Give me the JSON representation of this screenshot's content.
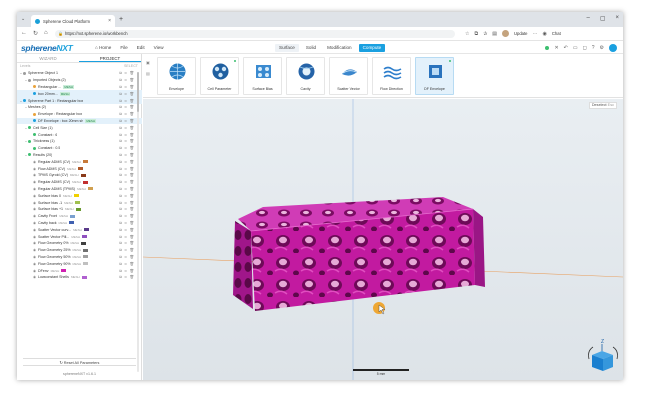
{
  "browser": {
    "tab_title": "Spherene Cloud Platform",
    "url": "https://nxt.spherene.io/workbench",
    "update_label": "Update",
    "profile_label": "Chat"
  },
  "app": {
    "logo": "sphereneNXT",
    "logo_main": "spherene",
    "logo_accent": "NXT",
    "menus": [
      "Home",
      "File",
      "Edit",
      "View"
    ],
    "modes": [
      "Surface",
      "Solid",
      "Modification",
      "Compute"
    ],
    "active_mode": "Surface",
    "user_initial": "B"
  },
  "left_panel": {
    "tabs": [
      "WIZARD",
      "PROJECT"
    ],
    "active_tab": "PROJECT",
    "sub_left": "Levels",
    "sub_right": "SELECT",
    "tree": [
      {
        "level": 0,
        "caret": "v",
        "label": "Spherene Object 1",
        "color": "#9b9b9b",
        "sel": false
      },
      {
        "level": 1,
        "caret": "v",
        "label": "Imported Objects (2)",
        "color": "#9b9b9b",
        "sel": false
      },
      {
        "level": 2,
        "caret": "",
        "label": "Rectangular ...",
        "mesh": "MESH",
        "color": "#e9a23b",
        "sel": false
      },
      {
        "level": 2,
        "caret": "",
        "label": "box 20mm...",
        "mesh": "MESH",
        "color": "#1aa0e0",
        "sel": true
      },
      {
        "level": 0,
        "caret": "v",
        "label": "Spherene Part 1 : Rectangular box",
        "color": "#1aa0e0",
        "sel": true
      },
      {
        "level": 1,
        "caret": "v",
        "label": "Meshes (2)",
        "color": "",
        "sel": false
      },
      {
        "level": 2,
        "caret": "",
        "label": "Envelope : Rectangular box",
        "color": "#e9a23b",
        "sel": false
      },
      {
        "level": 2,
        "caret": "",
        "label": "DF Envelope : box 20mm sh",
        "mesh": "MESH",
        "color": "#1aa0e0",
        "sel": true
      },
      {
        "level": 1,
        "caret": "v",
        "label": "Cell Size (1)",
        "color": "#3cbf6f",
        "sel": false
      },
      {
        "level": 2,
        "caret": "",
        "label": "Constant : 6",
        "color": "#3cbf6f",
        "sel": false
      },
      {
        "level": 1,
        "caret": "v",
        "label": "Thickness (1)",
        "color": "#3cbf6f",
        "sel": false
      },
      {
        "level": 2,
        "caret": "",
        "label": "Constant : 0.5",
        "color": "#3cbf6f",
        "sel": false
      },
      {
        "level": 1,
        "caret": "v",
        "label": "Results (20)",
        "color": "#3cbf6f",
        "sel": false
      },
      {
        "level": 2,
        "caret": "",
        "label": "Regular ADMS (CV)",
        "mesh": "MESH",
        "swatch": "#c77a3a",
        "sel": false
      },
      {
        "level": 2,
        "caret": "",
        "label": "Flow ADMS (CV)",
        "mesh": "MESH",
        "swatch": "#b05a2a",
        "sel": false
      },
      {
        "level": 2,
        "caret": "",
        "label": "TPMS Gyroid (CV)",
        "mesh": "MESH",
        "swatch": "#8a3a1a",
        "sel": false
      },
      {
        "level": 2,
        "caret": "",
        "label": "Regular ADMS (CV)",
        "mesh": "MESH",
        "swatch": "#c23030",
        "sel": false
      },
      {
        "level": 2,
        "caret": "",
        "label": "Regular ADMS (TPMS)",
        "mesh": "MESH",
        "swatch": "#d0a050",
        "sel": false
      },
      {
        "level": 2,
        "caret": "",
        "label": "Surface bias 0",
        "mesh": "MESH",
        "swatch": "#f0d000",
        "sel": false
      },
      {
        "level": 2,
        "caret": "",
        "label": "Surface bias -1",
        "mesh": "MESH",
        "swatch": "#a0c050",
        "sel": false
      },
      {
        "level": 2,
        "caret": "",
        "label": "Surface bias +1",
        "mesh": "MESH",
        "swatch": "#6a9a30",
        "sel": false
      },
      {
        "level": 2,
        "caret": "",
        "label": "Cavity Front",
        "mesh": "MESH",
        "swatch": "#7aa0d0",
        "sel": false
      },
      {
        "level": 2,
        "caret": "",
        "label": "Cavity back",
        "mesh": "MESH",
        "swatch": "#4060b0",
        "sel": false
      },
      {
        "level": 2,
        "caret": "",
        "label": "Scatter Vector curv...",
        "mesh": "MESH",
        "swatch": "#5a3a8a",
        "sel": false
      },
      {
        "level": 2,
        "caret": "",
        "label": "Scatter Vector Pill...",
        "mesh": "MESH",
        "swatch": "#9050c0",
        "sel": false
      },
      {
        "level": 2,
        "caret": "",
        "label": "Flow Geometry 0%",
        "mesh": "MESH",
        "swatch": "#404040",
        "sel": false
      },
      {
        "level": 2,
        "caret": "",
        "label": "Flow Geometry 25%",
        "mesh": "MESH",
        "swatch": "#707070",
        "sel": false
      },
      {
        "level": 2,
        "caret": "",
        "label": "Flow Geometry 50%",
        "mesh": "MESH",
        "swatch": "#a0a0a0",
        "sel": false
      },
      {
        "level": 2,
        "caret": "",
        "label": "Flow Geometry 90%",
        "mesh": "MESH",
        "swatch": "#c0c0c0",
        "sel": false
      },
      {
        "level": 2,
        "caret": "",
        "label": "DFenv",
        "mesh": "MESH",
        "swatch": "#d020b0",
        "sel": false
      },
      {
        "level": 2,
        "caret": "",
        "label": "Lowconstant Shells",
        "mesh": "MESH",
        "swatch": "#b060d0",
        "sel": false
      }
    ],
    "reset_label": "Reset All Parameters",
    "version": "sphereneNXT v1.6.1"
  },
  "ribbon": {
    "items": [
      {
        "label": "Envelope",
        "icon": "sphere-envelope-icon",
        "dot": false
      },
      {
        "label": "Cell Parameter",
        "icon": "cell-parameter-icon",
        "dot": true
      },
      {
        "label": "Surface Bias",
        "icon": "surface-bias-icon",
        "dot": false
      },
      {
        "label": "Cavity",
        "icon": "cavity-icon",
        "dot": false
      },
      {
        "label": "Scatter Vector",
        "icon": "scatter-vector-icon",
        "dot": false
      },
      {
        "label": "Flow Direction",
        "icon": "flow-direction-icon",
        "dot": false
      },
      {
        "label": "DF Envelope",
        "icon": "df-envelope-icon",
        "dot": true
      }
    ],
    "selected": "DF Envelope"
  },
  "viewport": {
    "deselect_label": "Deselect",
    "deselect_key": "Esc",
    "scale_label": "5 mm",
    "model_color": "#c21aa0",
    "axis_label": "Z"
  }
}
